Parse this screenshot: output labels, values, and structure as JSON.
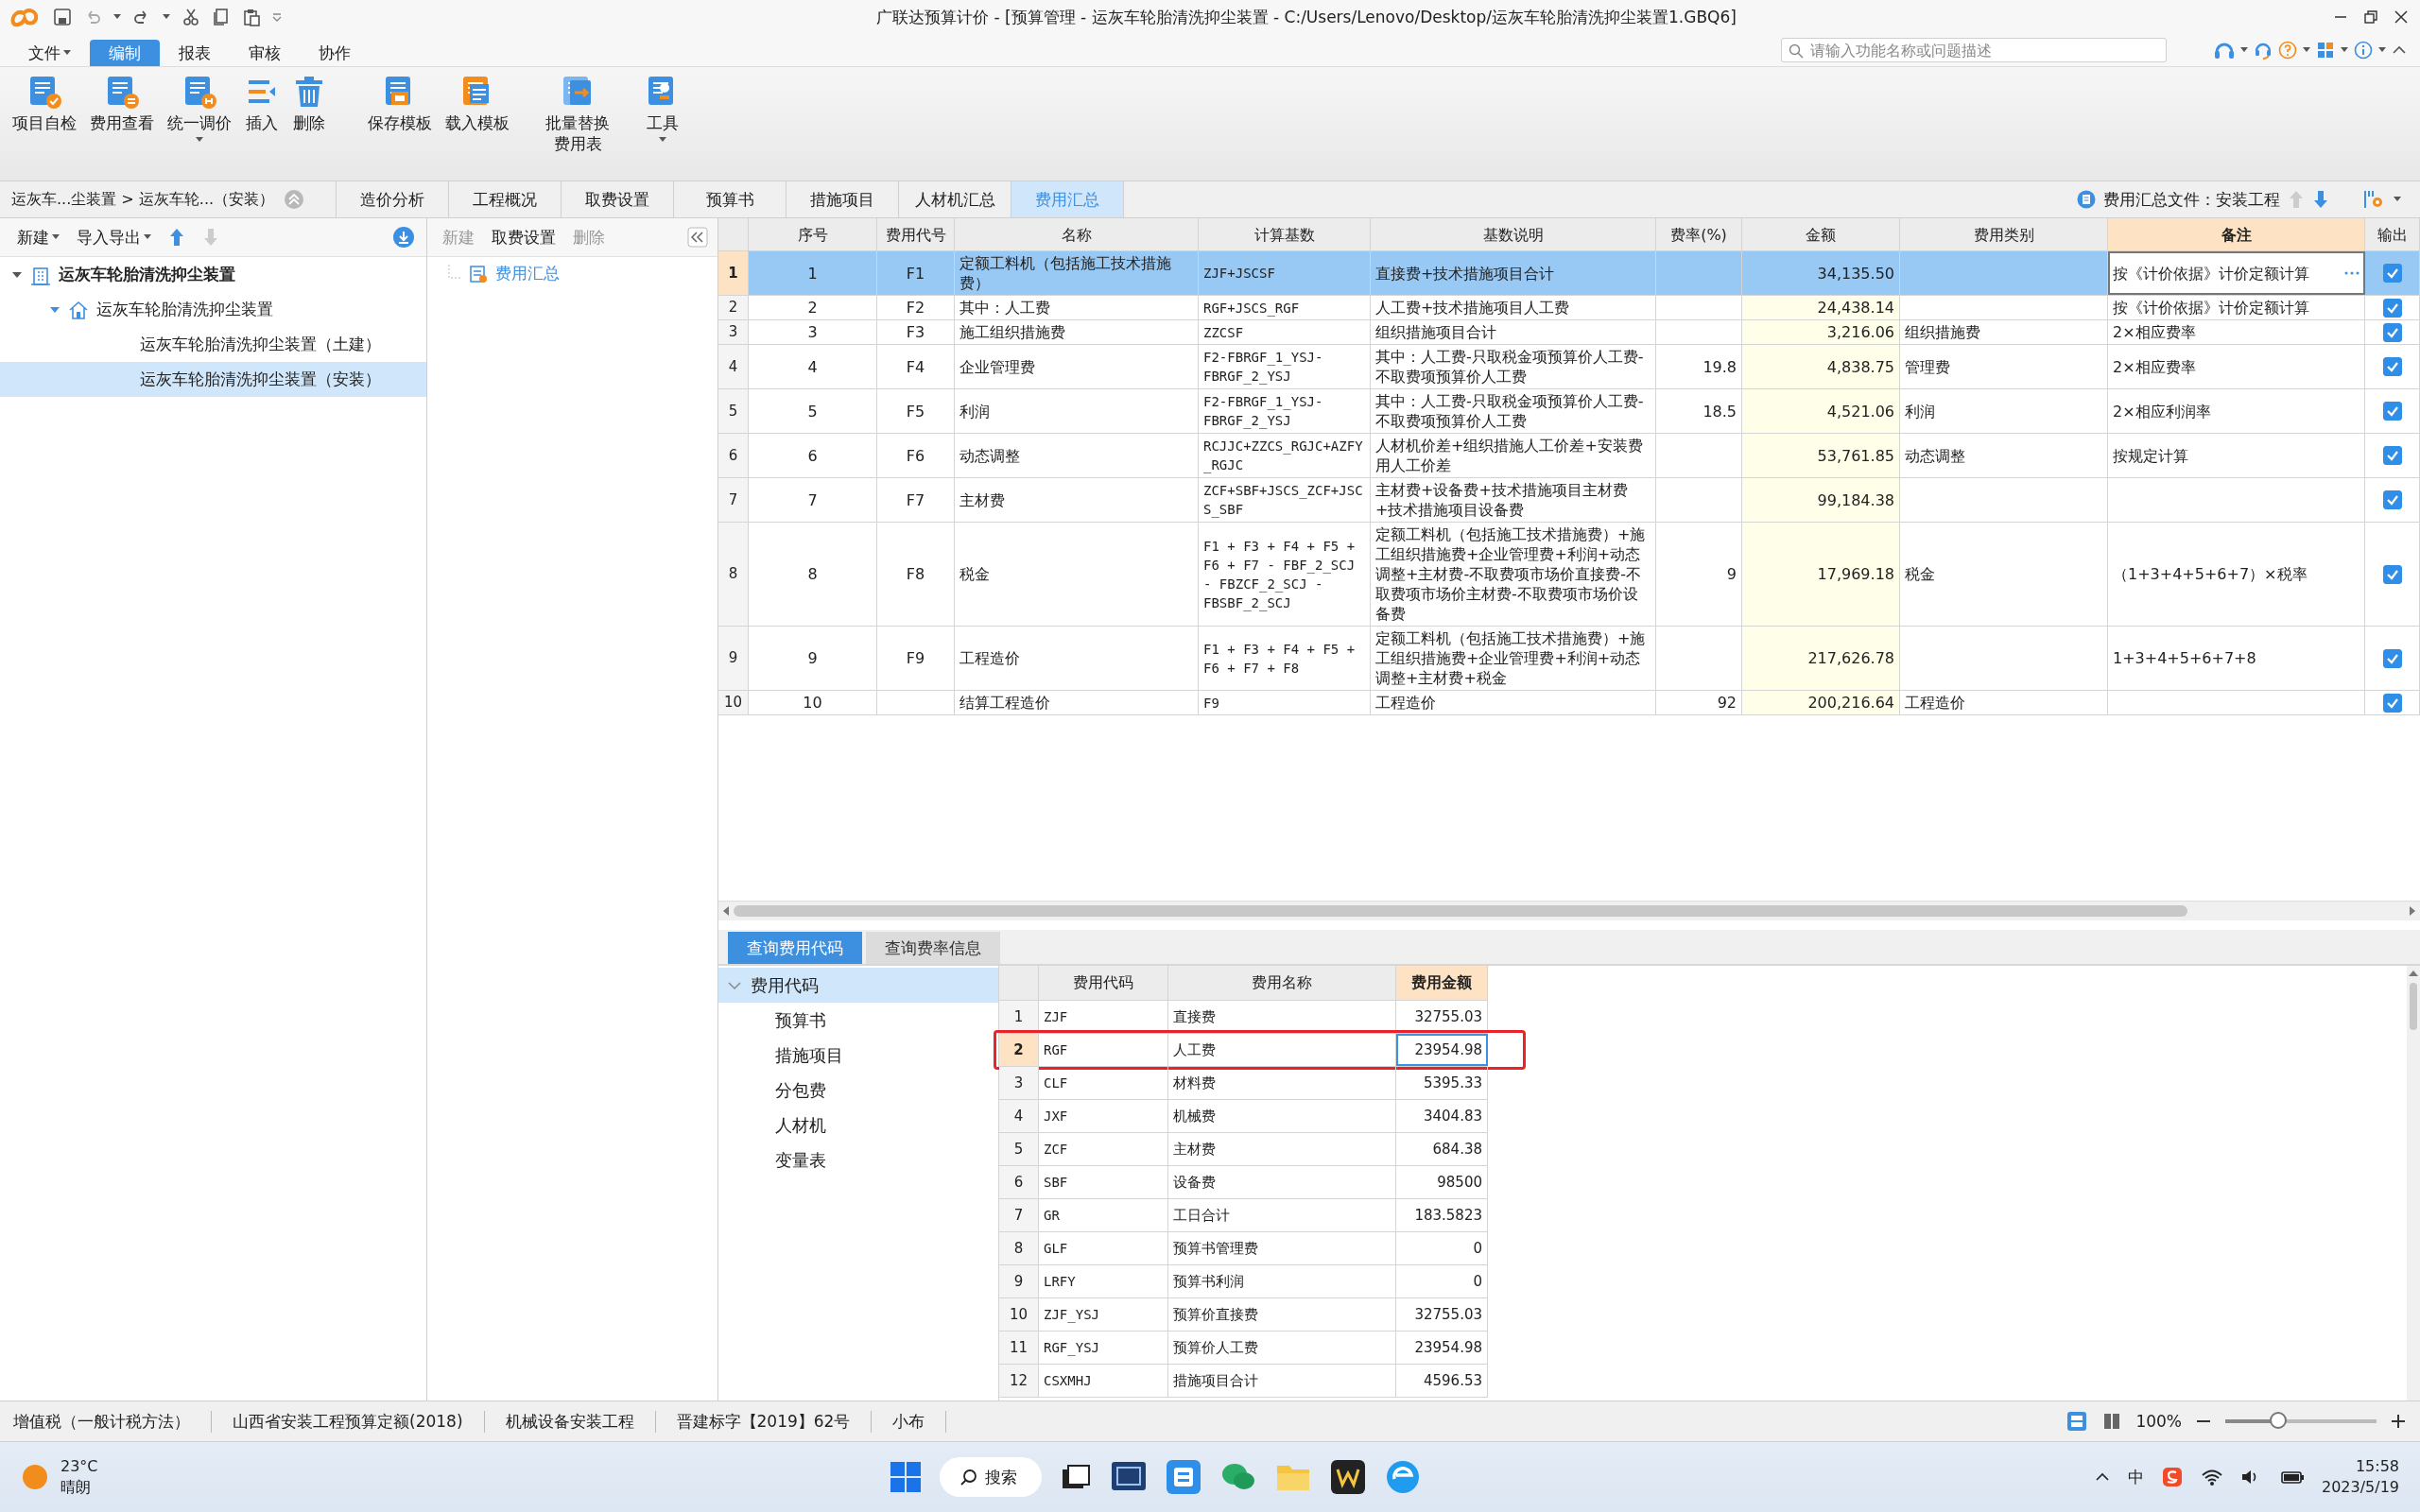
{
  "window": {
    "title": "广联达预算计价 - [预算管理 - 运灰车轮胎清洗抑尘装置 - C:/Users/Lenovo/Desktop/运灰车轮胎清洗抑尘装置1.GBQ6]"
  },
  "menu": [
    {
      "label": "文件",
      "dropdown": true,
      "selected": false
    },
    {
      "label": "编制",
      "dropdown": false,
      "selected": true
    },
    {
      "label": "报表",
      "dropdown": false,
      "selected": false
    },
    {
      "label": "审核",
      "dropdown": false,
      "selected": false
    },
    {
      "label": "协作",
      "dropdown": false,
      "selected": false
    }
  ],
  "search": {
    "placeholder": "请输入功能名称或问题描述"
  },
  "ribbon": [
    {
      "kind": "check",
      "label": "项目自检",
      "dropdown": false
    },
    {
      "kind": "view",
      "label": "费用查看",
      "dropdown": false
    },
    {
      "kind": "adjust",
      "label": "统一调价",
      "dropdown": true
    },
    {
      "kind": "insert",
      "label": "插入",
      "dropdown": false
    },
    {
      "kind": "delete",
      "label": "删除",
      "dropdown": false
    },
    {
      "kind": "save",
      "label": "保存模板",
      "dropdown": false
    },
    {
      "kind": "load",
      "label": "载入模板",
      "dropdown": false
    },
    {
      "kind": "replace",
      "label": "批量替换费用表",
      "dropdown": false
    },
    {
      "kind": "tool",
      "label": "工具",
      "dropdown": true
    }
  ],
  "breadcrumb": "运灰车...尘装置 > 运灰车轮...（安装）",
  "view_tabs": [
    {
      "label": "造价分析",
      "selected": false
    },
    {
      "label": "工程概况",
      "selected": false
    },
    {
      "label": "取费设置",
      "selected": false
    },
    {
      "label": "预算书",
      "selected": false
    },
    {
      "label": "措施项目",
      "selected": false
    },
    {
      "label": "人材机汇总",
      "selected": false
    },
    {
      "label": "费用汇总",
      "selected": true
    }
  ],
  "summary_file": "费用汇总文件：安装工程",
  "left_toolbar": [
    {
      "label": "新建",
      "dropdown": true
    },
    {
      "label": "导入导出",
      "dropdown": true
    }
  ],
  "project_tree": [
    {
      "kind": "project",
      "label": "运灰车轮胎清洗抑尘装置",
      "expanded": true,
      "selected": false,
      "children": [
        {
          "kind": "unit",
          "label": "运灰车轮胎清洗抑尘装置",
          "expanded": true,
          "selected": false,
          "children": [
            {
              "label": "运灰车轮胎清洗抑尘装置（土建）",
              "selected": false
            },
            {
              "label": "运灰车轮胎清洗抑尘装置（安装）",
              "selected": true
            }
          ]
        }
      ]
    }
  ],
  "middle_toolbar": [
    {
      "label": "新建",
      "disabled": true
    },
    {
      "label": "取费设置",
      "disabled": false
    },
    {
      "label": "删除",
      "disabled": true
    }
  ],
  "middle_item": "费用汇总",
  "summary_table": {
    "columns": [
      {
        "label": "序号",
        "selected": false
      },
      {
        "label": "费用代号",
        "selected": false
      },
      {
        "label": "名称",
        "selected": false
      },
      {
        "label": "计算基数",
        "selected": false
      },
      {
        "label": "基数说明",
        "selected": false
      },
      {
        "label": "费率(%)",
        "selected": false
      },
      {
        "label": "金额",
        "selected": false
      },
      {
        "label": "费用类别",
        "selected": false
      },
      {
        "label": "备注",
        "selected": true
      },
      {
        "label": "输出",
        "selected": false
      }
    ],
    "rows": [
      {
        "index": "1",
        "seq": "1",
        "code": "F1",
        "name": "定额工料机（包括施工技术措施费）",
        "base": "ZJF+JSCSF",
        "base_desc": "直接费+技术措施项目合计",
        "amount": "34,135.50",
        "note": "按《计价依据》计价定额计算",
        "output": true,
        "selected": true,
        "editing": true
      },
      {
        "index": "2",
        "seq": "2",
        "code": "F2",
        "name": "其中：人工费",
        "base": "RGF+JSCS_RGF",
        "base_desc": "人工费+技术措施项目人工费",
        "amount": "24,438.14",
        "note": "按《计价依据》计价定额计算",
        "output": true,
        "selected": false,
        "editing": false
      },
      {
        "index": "3",
        "seq": "3",
        "code": "F3",
        "name": "施工组织措施费",
        "base": "ZZCSF",
        "base_desc": "组织措施项目合计",
        "amount": "3,216.06",
        "category": "组织措施费",
        "note": "2×相应费率",
        "output": true,
        "selected": false,
        "editing": false
      },
      {
        "index": "4",
        "seq": "4",
        "code": "F4",
        "name": "企业管理费",
        "base": "F2-FBRGF_1_YSJ-FBRGF_2_YSJ",
        "base_desc": "其中：人工费-只取税金项预算价人工费-不取费项预算价人工费",
        "rate": "19.8",
        "amount": "4,838.75",
        "category": "管理费",
        "note": "2×相应费率",
        "output": true,
        "selected": false,
        "editing": false
      },
      {
        "index": "5",
        "seq": "5",
        "code": "F5",
        "name": "利润",
        "base": "F2-FBRGF_1_YSJ-FBRGF_2_YSJ",
        "base_desc": "其中：人工费-只取税金项预算价人工费-不取费项预算价人工费",
        "rate": "18.5",
        "amount": "4,521.06",
        "category": "利润",
        "note": "2×相应利润率",
        "output": true,
        "selected": false,
        "editing": false
      },
      {
        "index": "6",
        "seq": "6",
        "code": "F6",
        "name": "动态调整",
        "base": "RCJJC+ZZCS_RGJC+AZFY_RGJC",
        "base_desc": "人材机价差+组织措施人工价差+安装费用人工价差",
        "amount": "53,761.85",
        "category": "动态调整",
        "note": "按规定计算",
        "output": true,
        "selected": false,
        "editing": false
      },
      {
        "index": "7",
        "seq": "7",
        "code": "F7",
        "name": "主材费",
        "base": "ZCF+SBF+JSCS_ZCF+JSCS_SBF",
        "base_desc": "主材费+设备费+技术措施项目主材费+技术措施项目设备费",
        "amount": "99,184.38",
        "output": true,
        "selected": false,
        "editing": false
      },
      {
        "index": "8",
        "seq": "8",
        "code": "F8",
        "name": "税金",
        "base": "F1 + F3 + F4 + F5 + F6 + F7 - FBF_2_SCJ - FBZCF_2_SCJ - FBSBF_2_SCJ",
        "base_desc": "定额工料机（包括施工技术措施费）+施工组织措施费+企业管理费+利润+动态调整+主材费-不取费项市场价直接费-不取费项市场价主材费-不取费项市场价设备费",
        "rate": "9",
        "amount": "17,969.18",
        "category": "税金",
        "note": "（1+3+4+5+6+7）×税率",
        "output": true,
        "selected": false,
        "editing": false
      },
      {
        "index": "9",
        "seq": "9",
        "code": "F9",
        "name": "工程造价",
        "base": "F1 + F3 + F4 + F5 + F6 + F7 + F8",
        "base_desc": "定额工料机（包括施工技术措施费）+施工组织措施费+企业管理费+利润+动态调整+主材费+税金",
        "amount": "217,626.78",
        "note": "1+3+4+5+6+7+8",
        "output": true,
        "selected": false,
        "editing": false
      },
      {
        "index": "10",
        "seq": "10",
        "name": "结算工程造价",
        "base": "F9",
        "base_desc": "工程造价",
        "rate": "92",
        "amount": "200,216.64",
        "category": "工程造价",
        "output": true,
        "selected": false,
        "editing": false
      }
    ]
  },
  "bottom_tabs": [
    {
      "label": "查询费用代码",
      "selected": true
    },
    {
      "label": "查询费率信息",
      "selected": false
    }
  ],
  "code_tree": {
    "label": "费用代码",
    "expanded": true,
    "selected": true,
    "children": [
      {
        "label": "预算书",
        "selected": false
      },
      {
        "label": "措施项目",
        "selected": false
      },
      {
        "label": "分包费",
        "selected": false
      },
      {
        "label": "人材机",
        "selected": false
      },
      {
        "label": "变量表",
        "selected": false
      }
    ]
  },
  "code_table": {
    "columns": [
      {
        "label": "费用代码",
        "selected": false
      },
      {
        "label": "费用名称",
        "selected": false
      },
      {
        "label": "费用金额",
        "selected": true
      }
    ],
    "rows": [
      {
        "index": "1",
        "code": "ZJF",
        "name": "直接费",
        "amount": "32755.03",
        "selected": false,
        "highlighted": false
      },
      {
        "index": "2",
        "code": "RGF",
        "name": "人工费",
        "amount": "23954.98",
        "selected": true,
        "highlighted": true
      },
      {
        "index": "3",
        "code": "CLF",
        "name": "材料费",
        "amount": "5395.33",
        "selected": false,
        "highlighted": false
      },
      {
        "index": "4",
        "code": "JXF",
        "name": "机械费",
        "amount": "3404.83",
        "selected": false,
        "highlighted": false
      },
      {
        "index": "5",
        "code": "ZCF",
        "name": "主材费",
        "amount": "684.38",
        "selected": false,
        "highlighted": false
      },
      {
        "index": "6",
        "code": "SBF",
        "name": "设备费",
        "amount": "98500",
        "selected": false,
        "highlighted": false
      },
      {
        "index": "7",
        "code": "GR",
        "name": "工日合计",
        "amount": "183.5823",
        "selected": false,
        "highlighted": false
      },
      {
        "index": "8",
        "code": "GLF",
        "name": "预算书管理费",
        "amount": "0",
        "selected": false,
        "highlighted": false
      },
      {
        "index": "9",
        "code": "LRFY",
        "name": "预算书利润",
        "amount": "0",
        "selected": false,
        "highlighted": false
      },
      {
        "index": "10",
        "code": "ZJF_YSJ",
        "name": "预算价直接费",
        "amount": "32755.03",
        "selected": false,
        "highlighted": false
      },
      {
        "index": "11",
        "code": "RGF_YSJ",
        "name": "预算价人工费",
        "amount": "23954.98",
        "selected": false,
        "highlighted": false
      },
      {
        "index": "12",
        "code": "CSXMHJ",
        "name": "措施项目合计",
        "amount": "4596.53",
        "selected": false,
        "highlighted": false
      }
    ]
  },
  "status_bar": {
    "items": [
      "增值税（一般计税方法）",
      "山西省安装工程预算定额(2018)",
      "机械设备安装工程",
      "晋建标字【2019】62号",
      "小布"
    ],
    "zoom": "100%",
    "zoom_slider": {
      "level": 0.35
    }
  },
  "taskbar": {
    "temperature": "23°C",
    "weather": "晴朗",
    "search": "搜索",
    "ime": "中",
    "time": "15:58",
    "date": "2023/5/19"
  }
}
